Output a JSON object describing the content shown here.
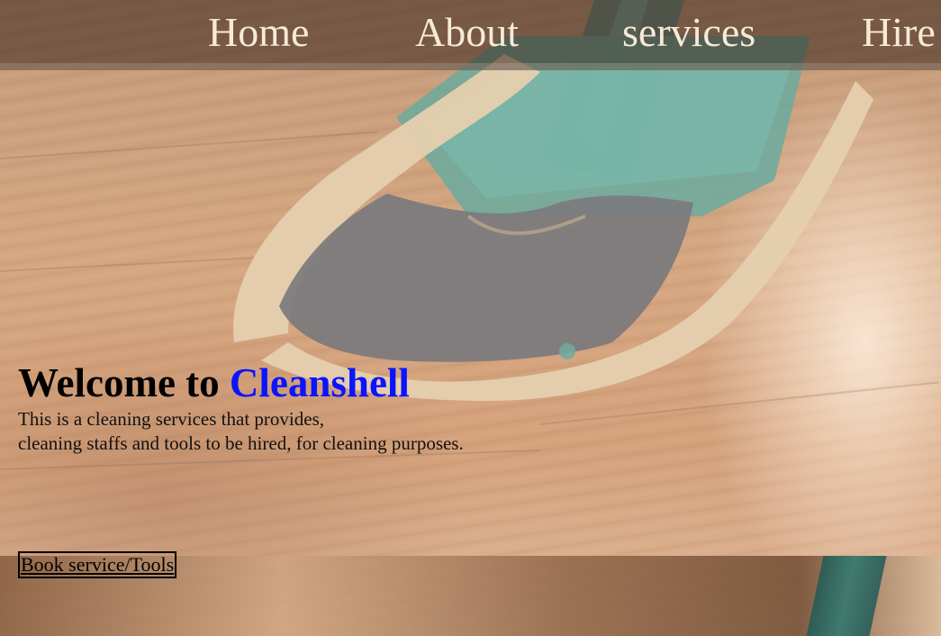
{
  "nav": {
    "items": [
      {
        "label": "Home"
      },
      {
        "label": "About"
      },
      {
        "label": "services"
      },
      {
        "label": "Hire"
      }
    ]
  },
  "hero": {
    "title_prefix": "Welcome to",
    "brand_name": "Cleanshell",
    "description_line1": "This is a cleaning services that provides,",
    "description_line2": "cleaning staffs and tools to be hired, for cleaning purposes.",
    "cta_label": "Book service/Tools",
    "background_image": "mop-on-wood-floor"
  },
  "colors": {
    "brand": "#0a14ff",
    "nav_text": "#f6ead6",
    "nav_bar": "rgba(55,35,25,0.55)"
  }
}
